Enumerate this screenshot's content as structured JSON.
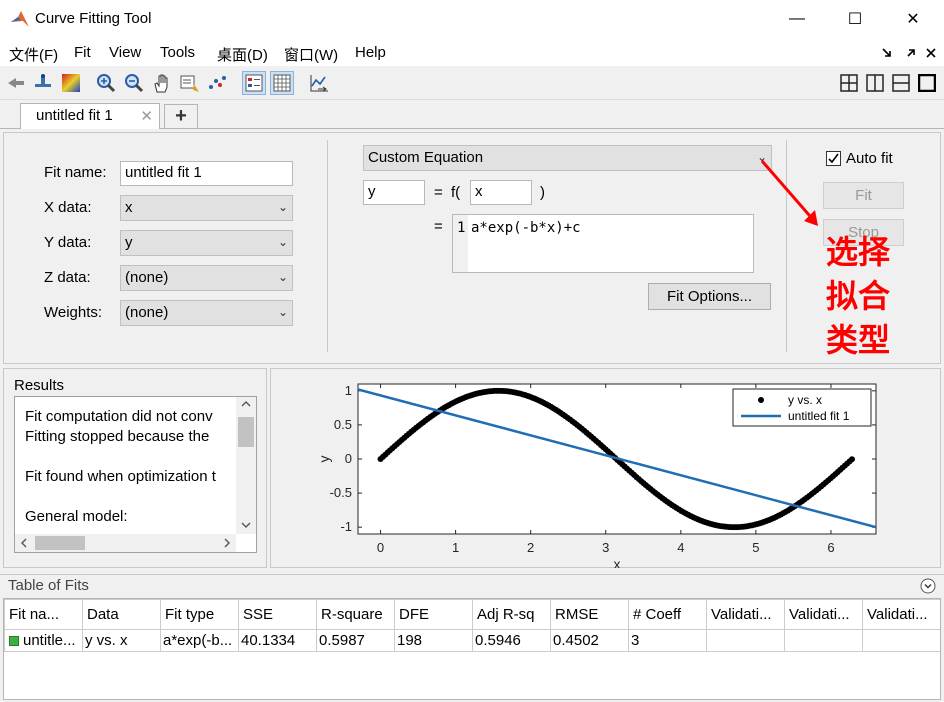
{
  "window": {
    "title": "Curve Fitting Tool",
    "minimize": "—",
    "maximize": "☐",
    "close": "✕"
  },
  "menu": [
    "文件(F)",
    "Fit",
    "View",
    "Tools",
    "桌面(D)",
    "窗口(W)",
    "Help"
  ],
  "tabs": {
    "active": "untitled fit 1",
    "close_glyph": "✕",
    "add_glyph": "+"
  },
  "fit_form": {
    "fit_name_label": "Fit name:",
    "fit_name": "untitled fit 1",
    "x_label": "X data:",
    "x_value": "x",
    "y_label": "Y data:",
    "y_value": "y",
    "z_label": "Z data:",
    "z_value": "(none)",
    "w_label": "Weights:",
    "w_value": "(none)"
  },
  "equation": {
    "type": "Custom Equation",
    "dependent": "y",
    "eq_sign": "=",
    "func_open": "f(",
    "independent": "x",
    "func_close": ")",
    "eq_sign2": "=",
    "line_no": "1",
    "expression": "a*exp(-b*x)+c",
    "fit_options_label": "Fit Options..."
  },
  "controls": {
    "auto_fit_label": "Auto fit",
    "auto_fit": true,
    "fit_label": "Fit",
    "stop_label": "Stop"
  },
  "annotation": [
    "选择",
    "拟合",
    "类型"
  ],
  "results": {
    "title": "Results",
    "lines": [
      "Fit computation did not conv",
      "Fitting stopped because the",
      "",
      "Fit found when optimization t",
      "",
      "General model:"
    ]
  },
  "chart_data": {
    "type": "line",
    "xlabel": "x",
    "ylabel": "y",
    "xlim": [
      -0.3,
      6.6
    ],
    "ylim": [
      -1.1,
      1.1
    ],
    "xticks": [
      0,
      1,
      2,
      3,
      4,
      5,
      6
    ],
    "yticks": [
      1,
      0.5,
      0,
      -0.5,
      -1
    ],
    "ytick_labels": [
      "1",
      "0.5",
      "0",
      "-0.5",
      "-1"
    ],
    "grid": false,
    "legend_position": "top-right",
    "series": [
      {
        "name": "y vs. x",
        "style": "points",
        "color": "#000000",
        "function": "sin",
        "x_range": [
          0,
          6.28
        ],
        "n_points": 200
      },
      {
        "name": "untitled fit 1",
        "style": "line",
        "color": "#1f6db2",
        "x": [
          -0.3,
          6.6
        ],
        "y": [
          1.02,
          -1.0
        ]
      }
    ]
  },
  "table": {
    "title": "Table of Fits",
    "columns": [
      "Fit na...",
      "Data",
      "Fit type",
      "SSE",
      "R-square",
      "DFE",
      "Adj R-sq",
      "RMSE",
      "# Coeff",
      "Validati...",
      "Validati...",
      "Validati..."
    ],
    "rows": [
      [
        "untitle...",
        "y vs. x",
        "a*exp(-b...",
        "40.1334",
        "0.5987",
        "198",
        "0.5946",
        "0.4502",
        "3",
        "",
        "",
        ""
      ]
    ],
    "status_color": "#3cb043"
  },
  "colors": {
    "annotation": "#ff0000",
    "fit_line": "#1f6db2",
    "accent": "#1f6db2"
  }
}
